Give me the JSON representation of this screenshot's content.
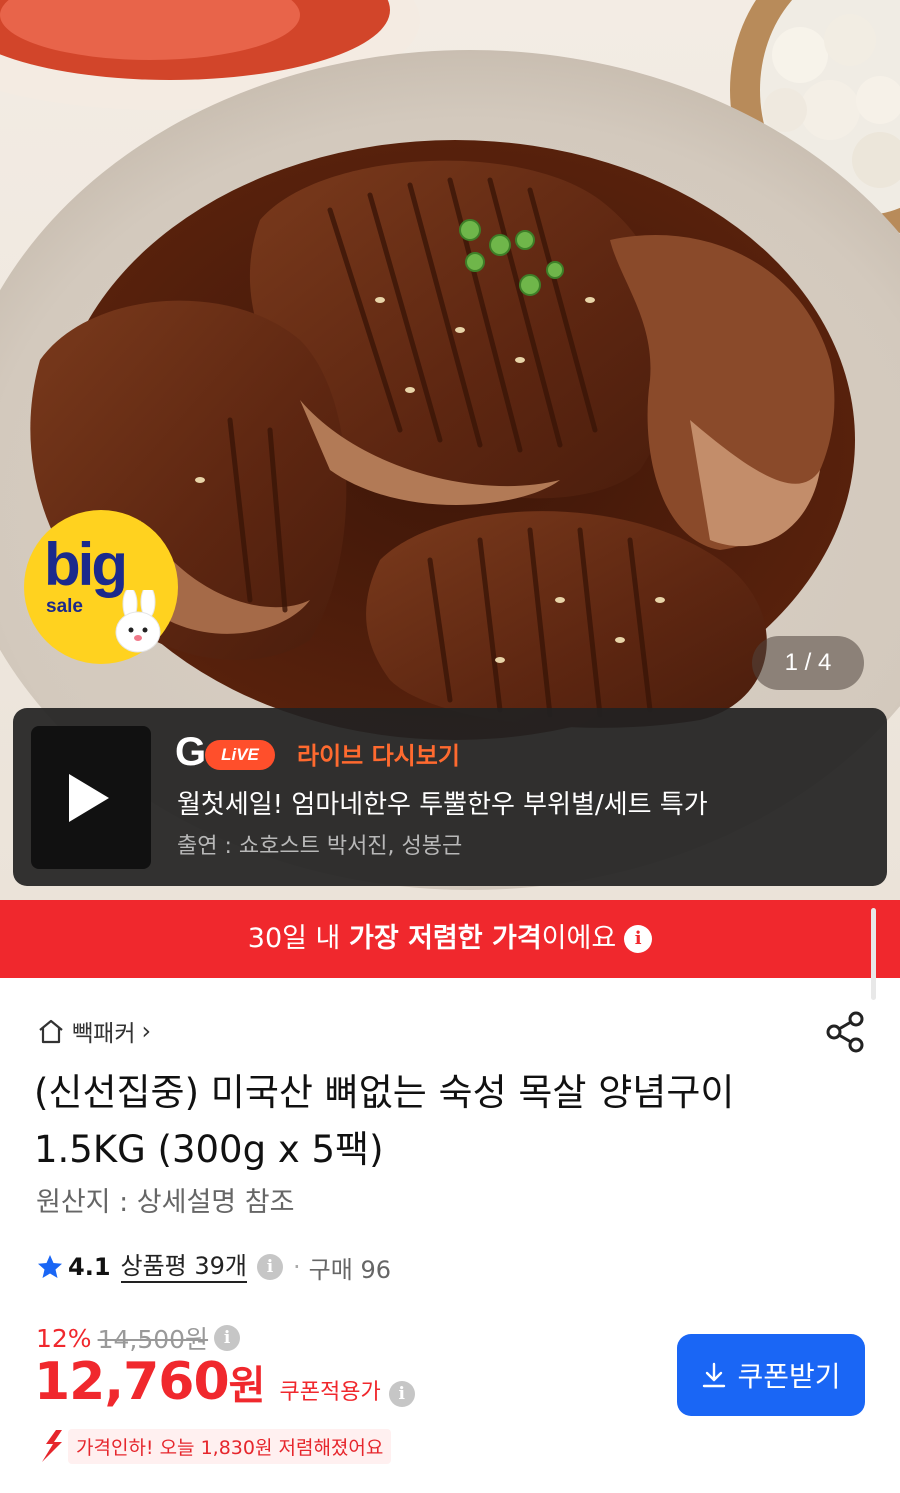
{
  "hero": {
    "badge_big": "big",
    "badge_sale": "sale",
    "pager": "1 / 4"
  },
  "live": {
    "g_mark": "G",
    "live_pill": "LiVE",
    "replay_label": "라이브 다시보기",
    "title": "월첫세일! 엄마네한우 투뿔한우 부위별/세트 특가",
    "cast": "출연 : 쇼호스트 박서진, 성봉근"
  },
  "lowest_banner": {
    "prefix": "30일 내 ",
    "highlight": "가장 저렴한 가격",
    "suffix": "이에요"
  },
  "product": {
    "store_name": "빽패커",
    "store_chevron": "›",
    "title": "(신선집중) 미국산 뼈없는 숙성 목살 양념구이 1.5KG (300g x 5팩)",
    "origin": "원산지 : 상세설명 참조",
    "rating": "4.1",
    "reviews": "상품평 39개",
    "dot": "·",
    "purchases": "구매 96",
    "discount_pct": "12%",
    "original_price": "14,500원",
    "price": "12,760",
    "won": "원",
    "coupon_applied_label": "쿠폰적용가",
    "coupon_button": "쿠폰받기",
    "price_drop": "가격인하! 오늘 1,830원 저렴해졌어요"
  },
  "info_glyph": "i",
  "colors": {
    "accent_red": "#f0282d",
    "coupon_blue": "#1a66f5",
    "badge_yellow": "#ffd21f",
    "live_orange": "#ff6a2f"
  }
}
